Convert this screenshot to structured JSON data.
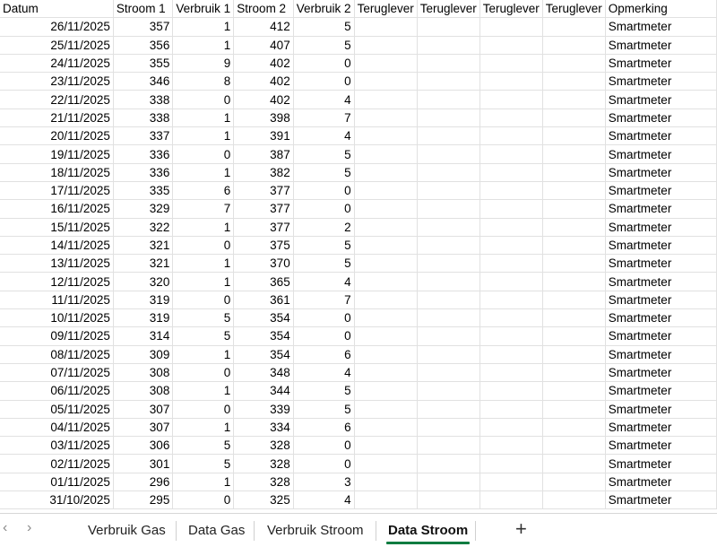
{
  "columns": [
    "Datum",
    "Stroom 1",
    "Verbruik 1",
    "Stroom 2",
    "Verbruik 2",
    "Teruglever",
    "Teruglever",
    "Teruglever",
    "Teruglever",
    "Opmerking"
  ],
  "rows": [
    [
      "26/11/2025",
      "357",
      "1",
      "412",
      "5",
      "",
      "",
      "",
      "",
      "Smartmeter"
    ],
    [
      "25/11/2025",
      "356",
      "1",
      "407",
      "5",
      "",
      "",
      "",
      "",
      "Smartmeter"
    ],
    [
      "24/11/2025",
      "355",
      "9",
      "402",
      "0",
      "",
      "",
      "",
      "",
      "Smartmeter"
    ],
    [
      "23/11/2025",
      "346",
      "8",
      "402",
      "0",
      "",
      "",
      "",
      "",
      "Smartmeter"
    ],
    [
      "22/11/2025",
      "338",
      "0",
      "402",
      "4",
      "",
      "",
      "",
      "",
      "Smartmeter"
    ],
    [
      "21/11/2025",
      "338",
      "1",
      "398",
      "7",
      "",
      "",
      "",
      "",
      "Smartmeter"
    ],
    [
      "20/11/2025",
      "337",
      "1",
      "391",
      "4",
      "",
      "",
      "",
      "",
      "Smartmeter"
    ],
    [
      "19/11/2025",
      "336",
      "0",
      "387",
      "5",
      "",
      "",
      "",
      "",
      "Smartmeter"
    ],
    [
      "18/11/2025",
      "336",
      "1",
      "382",
      "5",
      "",
      "",
      "",
      "",
      "Smartmeter"
    ],
    [
      "17/11/2025",
      "335",
      "6",
      "377",
      "0",
      "",
      "",
      "",
      "",
      "Smartmeter"
    ],
    [
      "16/11/2025",
      "329",
      "7",
      "377",
      "0",
      "",
      "",
      "",
      "",
      "Smartmeter"
    ],
    [
      "15/11/2025",
      "322",
      "1",
      "377",
      "2",
      "",
      "",
      "",
      "",
      "Smartmeter"
    ],
    [
      "14/11/2025",
      "321",
      "0",
      "375",
      "5",
      "",
      "",
      "",
      "",
      "Smartmeter"
    ],
    [
      "13/11/2025",
      "321",
      "1",
      "370",
      "5",
      "",
      "",
      "",
      "",
      "Smartmeter"
    ],
    [
      "12/11/2025",
      "320",
      "1",
      "365",
      "4",
      "",
      "",
      "",
      "",
      "Smartmeter"
    ],
    [
      "11/11/2025",
      "319",
      "0",
      "361",
      "7",
      "",
      "",
      "",
      "",
      "Smartmeter"
    ],
    [
      "10/11/2025",
      "319",
      "5",
      "354",
      "0",
      "",
      "",
      "",
      "",
      "Smartmeter"
    ],
    [
      "09/11/2025",
      "314",
      "5",
      "354",
      "0",
      "",
      "",
      "",
      "",
      "Smartmeter"
    ],
    [
      "08/11/2025",
      "309",
      "1",
      "354",
      "6",
      "",
      "",
      "",
      "",
      "Smartmeter"
    ],
    [
      "07/11/2025",
      "308",
      "0",
      "348",
      "4",
      "",
      "",
      "",
      "",
      "Smartmeter"
    ],
    [
      "06/11/2025",
      "308",
      "1",
      "344",
      "5",
      "",
      "",
      "",
      "",
      "Smartmeter"
    ],
    [
      "05/11/2025",
      "307",
      "0",
      "339",
      "5",
      "",
      "",
      "",
      "",
      "Smartmeter"
    ],
    [
      "04/11/2025",
      "307",
      "1",
      "334",
      "6",
      "",
      "",
      "",
      "",
      "Smartmeter"
    ],
    [
      "03/11/2025",
      "306",
      "5",
      "328",
      "0",
      "",
      "",
      "",
      "",
      "Smartmeter"
    ],
    [
      "02/11/2025",
      "301",
      "5",
      "328",
      "0",
      "",
      "",
      "",
      "",
      "Smartmeter"
    ],
    [
      "01/11/2025",
      "296",
      "1",
      "328",
      "3",
      "",
      "",
      "",
      "",
      "Smartmeter"
    ],
    [
      "31/10/2025",
      "295",
      "0",
      "325",
      "4",
      "",
      "",
      "",
      "",
      "Smartmeter"
    ]
  ],
  "tabs": {
    "prev_icon": "chevron-left-icon",
    "next_icon": "chevron-right-icon",
    "prev_glyph": "‹",
    "next_glyph": "›",
    "items": [
      "Verbruik Gas",
      "Data Gas",
      "Verbruik Stroom",
      "Data Stroom"
    ],
    "active": "Data Stroom",
    "add_glyph": "+",
    "accent": "#107c41"
  }
}
